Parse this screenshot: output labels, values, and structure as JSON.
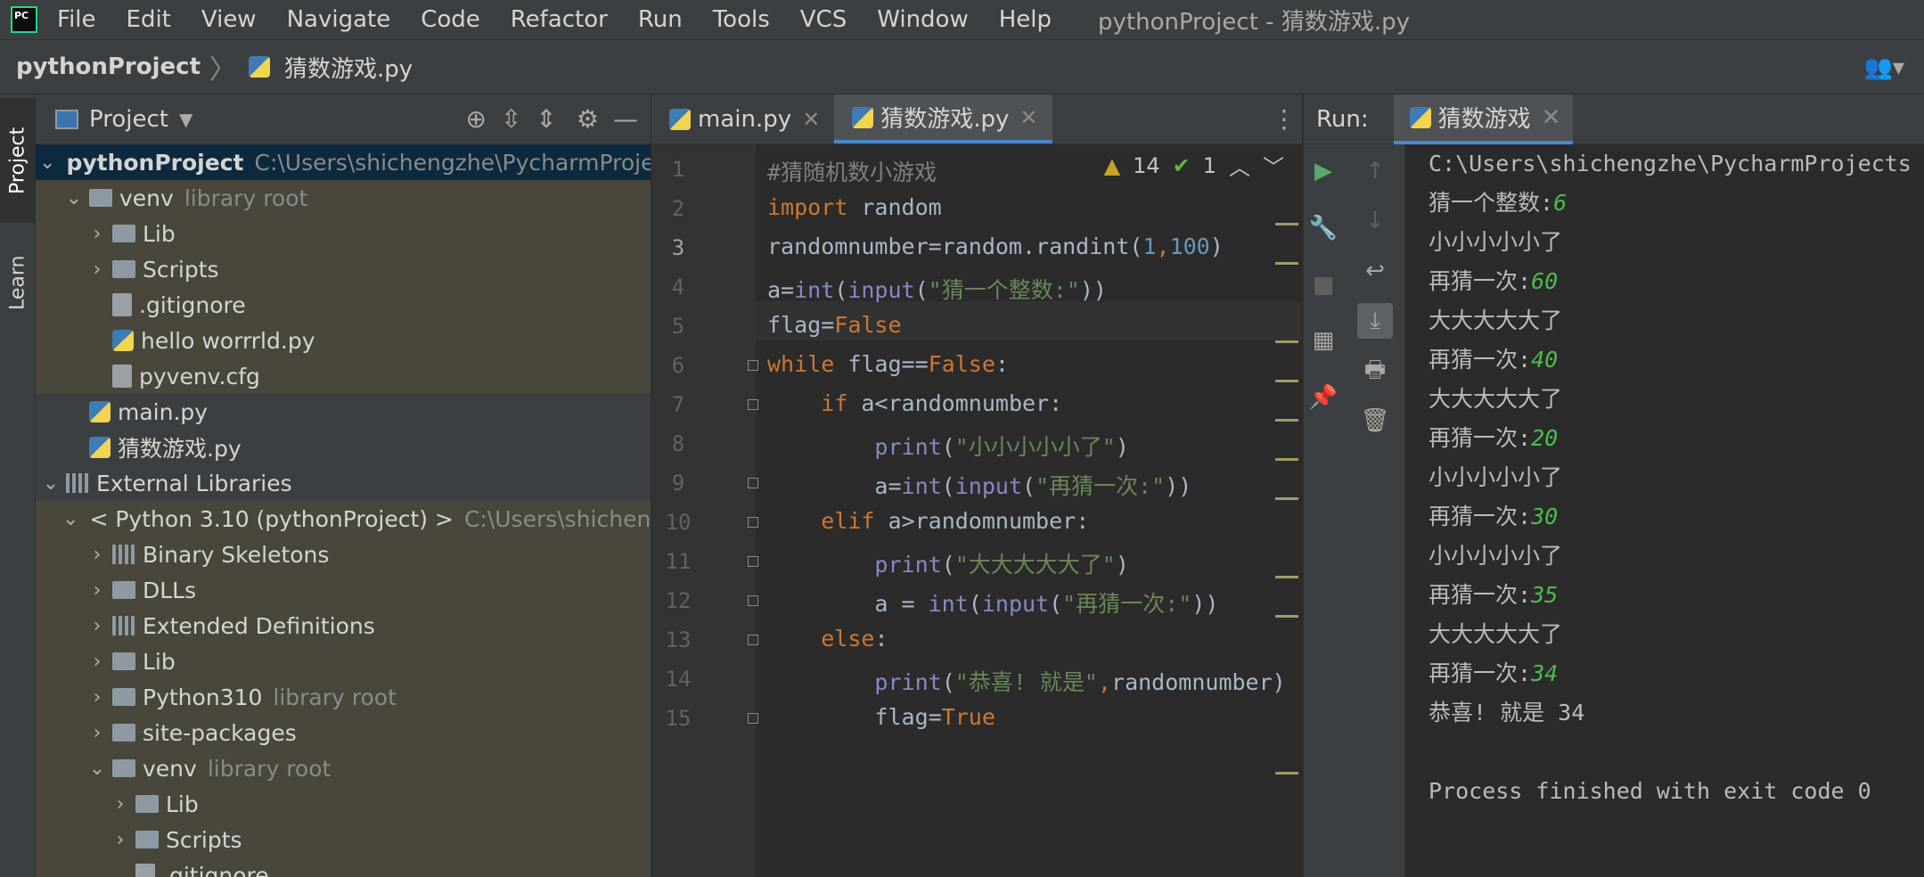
{
  "app": {
    "logo_text": "PC",
    "window_title": "pythonProject - 猜数游戏.py"
  },
  "menu": [
    "File",
    "Edit",
    "View",
    "Navigate",
    "Code",
    "Refactor",
    "Run",
    "Tools",
    "VCS",
    "Window",
    "Help"
  ],
  "breadcrumb": {
    "root": "pythonProject",
    "file": "猜数游戏.py"
  },
  "left_strip": {
    "project_tab": "Project",
    "learn_tab": "Learn"
  },
  "project_panel": {
    "title": "Project",
    "tree": [
      {
        "depth": 0,
        "kind": "folder",
        "arrow": "down",
        "name": "pythonProject",
        "hint": "C:\\Users\\shichengzhe\\PycharmProjects",
        "selected": true,
        "bold": true
      },
      {
        "depth": 1,
        "kind": "folder",
        "arrow": "down",
        "name": "venv",
        "hint": "library root",
        "lib": true
      },
      {
        "depth": 2,
        "kind": "folder",
        "arrow": "right",
        "name": "Lib",
        "hint": "",
        "lib": true
      },
      {
        "depth": 2,
        "kind": "folder",
        "arrow": "right",
        "name": "Scripts",
        "hint": "",
        "lib": true
      },
      {
        "depth": 2,
        "kind": "file",
        "arrow": "",
        "name": ".gitignore",
        "hint": "",
        "lib": true
      },
      {
        "depth": 2,
        "kind": "py",
        "arrow": "",
        "name": "hello worrrld.py",
        "hint": "",
        "lib": true
      },
      {
        "depth": 2,
        "kind": "file",
        "arrow": "",
        "name": "pyvenv.cfg",
        "hint": "",
        "lib": true
      },
      {
        "depth": 1,
        "kind": "py",
        "arrow": "",
        "name": "main.py",
        "hint": ""
      },
      {
        "depth": 1,
        "kind": "py",
        "arrow": "",
        "name": "猜数游戏.py",
        "hint": ""
      },
      {
        "depth": 0,
        "kind": "libs",
        "arrow": "down",
        "name": "External Libraries",
        "hint": ""
      },
      {
        "depth": 1,
        "kind": "py",
        "arrow": "down",
        "name": "< Python 3.10 (pythonProject) >",
        "hint": "C:\\Users\\shichengzhe",
        "lib": true
      },
      {
        "depth": 2,
        "kind": "libs",
        "arrow": "right",
        "name": "Binary Skeletons",
        "hint": "",
        "lib": true
      },
      {
        "depth": 2,
        "kind": "folder",
        "arrow": "right",
        "name": "DLLs",
        "hint": "",
        "lib": true
      },
      {
        "depth": 2,
        "kind": "libs",
        "arrow": "right",
        "name": "Extended Definitions",
        "hint": "",
        "lib": true
      },
      {
        "depth": 2,
        "kind": "folder",
        "arrow": "right",
        "name": "Lib",
        "hint": "",
        "lib": true
      },
      {
        "depth": 2,
        "kind": "folder",
        "arrow": "right",
        "name": "Python310",
        "hint": "library root",
        "lib": true
      },
      {
        "depth": 2,
        "kind": "folder",
        "arrow": "right",
        "name": "site-packages",
        "hint": "",
        "lib": true
      },
      {
        "depth": 2,
        "kind": "folder",
        "arrow": "down",
        "name": "venv",
        "hint": "library root",
        "lib": true
      },
      {
        "depth": 3,
        "kind": "folder",
        "arrow": "right",
        "name": "Lib",
        "hint": "",
        "lib": true
      },
      {
        "depth": 3,
        "kind": "folder",
        "arrow": "right",
        "name": "Scripts",
        "hint": "",
        "lib": true
      },
      {
        "depth": 3,
        "kind": "file",
        "arrow": "",
        "name": ".gitignore",
        "hint": "",
        "lib": true
      }
    ]
  },
  "editor": {
    "tabs": [
      {
        "label": "main.py",
        "active": false
      },
      {
        "label": "猜数游戏.py",
        "active": true
      }
    ],
    "inspections": {
      "warnings": "14",
      "typos": "1"
    },
    "current_line": 3,
    "lines": [
      [
        {
          "t": "#猜随机数小游戏",
          "c": "com"
        }
      ],
      [
        {
          "t": "import",
          "c": "kw"
        },
        {
          "t": " random",
          "c": ""
        }
      ],
      [
        {
          "t": "randomnumber=random.randint(",
          "c": ""
        },
        {
          "t": "1",
          "c": "num"
        },
        {
          "t": ",",
          "c": "kw"
        },
        {
          "t": "100",
          "c": "num"
        },
        {
          "t": ")",
          "c": ""
        }
      ],
      [
        {
          "t": "a=",
          "c": ""
        },
        {
          "t": "int",
          "c": "bi"
        },
        {
          "t": "(",
          "c": ""
        },
        {
          "t": "input",
          "c": "bi"
        },
        {
          "t": "(",
          "c": ""
        },
        {
          "t": "\"猜一个整数:\"",
          "c": "str"
        },
        {
          "t": "))",
          "c": ""
        }
      ],
      [
        {
          "t": "flag=",
          "c": ""
        },
        {
          "t": "False",
          "c": "kw"
        }
      ],
      [
        {
          "t": "while",
          "c": "kw"
        },
        {
          "t": " flag==",
          "c": ""
        },
        {
          "t": "False",
          "c": "kw"
        },
        {
          "t": ":",
          "c": ""
        }
      ],
      [
        {
          "t": "    ",
          "c": ""
        },
        {
          "t": "if",
          "c": "kw"
        },
        {
          "t": " a<randomnumber:",
          "c": ""
        }
      ],
      [
        {
          "t": "        ",
          "c": ""
        },
        {
          "t": "print",
          "c": "bi"
        },
        {
          "t": "(",
          "c": ""
        },
        {
          "t": "\"小小小小小了\"",
          "c": "str"
        },
        {
          "t": ")",
          "c": ""
        }
      ],
      [
        {
          "t": "        a=",
          "c": ""
        },
        {
          "t": "int",
          "c": "bi"
        },
        {
          "t": "(",
          "c": ""
        },
        {
          "t": "input",
          "c": "bi"
        },
        {
          "t": "(",
          "c": ""
        },
        {
          "t": "\"再猜一次:\"",
          "c": "str"
        },
        {
          "t": "))",
          "c": ""
        }
      ],
      [
        {
          "t": "    ",
          "c": ""
        },
        {
          "t": "elif",
          "c": "kw"
        },
        {
          "t": " a>randomnumber:",
          "c": ""
        }
      ],
      [
        {
          "t": "        ",
          "c": ""
        },
        {
          "t": "print",
          "c": "bi"
        },
        {
          "t": "(",
          "c": ""
        },
        {
          "t": "\"大大大大大了\"",
          "c": "str"
        },
        {
          "t": ")",
          "c": ""
        }
      ],
      [
        {
          "t": "        a = ",
          "c": ""
        },
        {
          "t": "int",
          "c": "bi"
        },
        {
          "t": "(",
          "c": ""
        },
        {
          "t": "input",
          "c": "bi"
        },
        {
          "t": "(",
          "c": ""
        },
        {
          "t": "\"再猜一次:\"",
          "c": "str"
        },
        {
          "t": "))",
          "c": ""
        }
      ],
      [
        {
          "t": "    ",
          "c": ""
        },
        {
          "t": "else",
          "c": "kw"
        },
        {
          "t": ":",
          "c": ""
        }
      ],
      [
        {
          "t": "        ",
          "c": ""
        },
        {
          "t": "print",
          "c": "bi"
        },
        {
          "t": "(",
          "c": ""
        },
        {
          "t": "\"恭喜! 就是\"",
          "c": "str"
        },
        {
          "t": ",",
          "c": "kw"
        },
        {
          "t": "randomnumber)",
          "c": ""
        }
      ],
      [
        {
          "t": "        flag=",
          "c": ""
        },
        {
          "t": "True",
          "c": "kw"
        }
      ]
    ]
  },
  "run_panel": {
    "label": "Run:",
    "tab": "猜数游戏",
    "output": [
      {
        "text": "C:\\Users\\shichengzhe\\PycharmProjects",
        "input": ""
      },
      {
        "text": "猜一个整数:",
        "input": "6"
      },
      {
        "text": "小小小小小了",
        "input": ""
      },
      {
        "text": "再猜一次:",
        "input": "60"
      },
      {
        "text": "大大大大大了",
        "input": ""
      },
      {
        "text": "再猜一次:",
        "input": "40"
      },
      {
        "text": "大大大大大了",
        "input": ""
      },
      {
        "text": "再猜一次:",
        "input": "20"
      },
      {
        "text": "小小小小小了",
        "input": ""
      },
      {
        "text": "再猜一次:",
        "input": "30"
      },
      {
        "text": "小小小小小了",
        "input": ""
      },
      {
        "text": "再猜一次:",
        "input": "35"
      },
      {
        "text": "大大大大大了",
        "input": ""
      },
      {
        "text": "再猜一次:",
        "input": "34"
      },
      {
        "text": "恭喜! 就是 34",
        "input": ""
      },
      {
        "text": "",
        "input": ""
      },
      {
        "text": "Process finished with exit code 0",
        "input": ""
      }
    ]
  }
}
